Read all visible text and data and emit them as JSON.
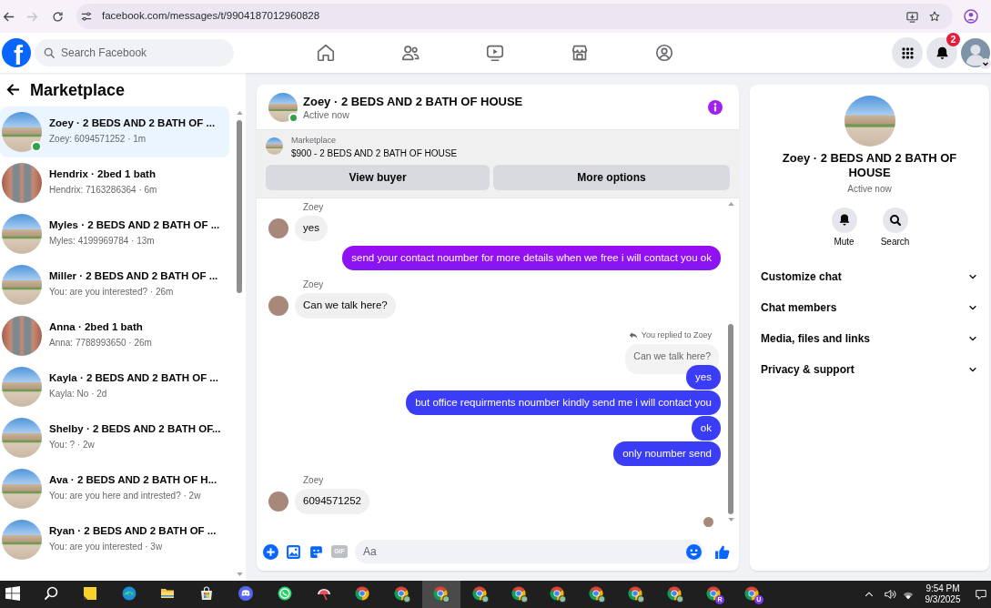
{
  "browser": {
    "url": "facebook.com/messages/t/9904187012960828",
    "forward_disabled": true
  },
  "topbar": {
    "logo": "f",
    "search_placeholder": "Search Facebook",
    "notification_count": "2"
  },
  "sidebar": {
    "title": "Marketplace",
    "conversations": [
      {
        "kind": "house",
        "title": "Zoey · 2 BEDS AND 2 BATH OF ...",
        "preview": "Zoey: 6094571252 · 1m",
        "selected": true,
        "online": true
      },
      {
        "kind": "brick",
        "title": "Hendrix · 2bed 1 bath",
        "preview": "Hendrix: 7163286364 · 6m",
        "selected": false,
        "online": false
      },
      {
        "kind": "house",
        "title": "Myles · 2 BEDS AND 2 BATH OF ...",
        "preview": "Myles: 4199969784 · 13m",
        "selected": false,
        "online": false
      },
      {
        "kind": "house",
        "title": "Miller · 2 BEDS AND 2 BATH OF ...",
        "preview": "You: are you interested? · 26m",
        "selected": false,
        "online": false
      },
      {
        "kind": "brick",
        "title": "Anna · 2bed 1 bath",
        "preview": "Anna: 7788993650 · 26m",
        "selected": false,
        "online": false
      },
      {
        "kind": "house",
        "title": "Kayla · 2 BEDS AND 2 BATH OF ...",
        "preview": "Kayla: No · 2d",
        "selected": false,
        "online": false
      },
      {
        "kind": "house",
        "title": "Shelby · 2 BEDS AND 2 BATH OF...",
        "preview": "You: ? · 2w",
        "selected": false,
        "online": false
      },
      {
        "kind": "house",
        "title": "Ava · 2 BEDS AND 2 BATH OF H...",
        "preview": "You: are you here and intrested? · 2w",
        "selected": false,
        "online": false
      },
      {
        "kind": "house",
        "title": "Ryan · 2 BEDS AND 2 BATH OF ...",
        "preview": "You: are you interested · 3w",
        "selected": false,
        "online": false
      }
    ]
  },
  "chat": {
    "title": "Zoey · 2 BEDS AND 2 BATH OF HOUSE",
    "status": "Active now",
    "online": true,
    "listing": {
      "label": "Marketplace",
      "title": "$900 - 2 BEDS AND 2 BATH OF HOUSE"
    },
    "actions": [
      "View buyer",
      "More options"
    ],
    "messages": [
      {
        "kind": "incoming",
        "sender": "Zoey",
        "text": "yes"
      },
      {
        "kind": "outgoing",
        "text": "send your contact noumber for more details when we free i will contact you ok"
      },
      {
        "kind": "incoming",
        "sender": "Zoey",
        "text": "Can we talk here?"
      },
      {
        "kind": "reply",
        "note": "You replied to Zoey",
        "quote": "Can we talk here?",
        "text": "yes"
      },
      {
        "kind": "outgoing",
        "text": "but office requirments noumber kindly send me i will contact you"
      },
      {
        "kind": "outgoing",
        "text": "ok"
      },
      {
        "kind": "outgoing",
        "text": "only noumber send"
      },
      {
        "kind": "incoming",
        "sender": "Zoey",
        "text": "6094571252"
      }
    ],
    "composer": {
      "gif_label": "GIF",
      "placeholder": "Aa"
    }
  },
  "details": {
    "title": "Zoey · 2 BEDS AND 2 BATH OF HOUSE",
    "status": "Active now",
    "actions": [
      {
        "kind": "mute",
        "label": "Mute"
      },
      {
        "kind": "search",
        "label": "Search"
      }
    ],
    "sections": [
      {
        "label": "Customize chat",
        "expanded": false
      },
      {
        "label": "Chat members",
        "expanded": false
      },
      {
        "label": "Media, files and links",
        "expanded": false
      },
      {
        "label": "Privacy & support",
        "expanded": false
      }
    ]
  },
  "taskbar": {
    "items": [
      {
        "kind": "start",
        "selected": false
      },
      {
        "kind": "search",
        "selected": false
      },
      {
        "kind": "notes",
        "selected": false
      },
      {
        "kind": "edge",
        "selected": false
      },
      {
        "kind": "explorer",
        "selected": false
      },
      {
        "kind": "store",
        "selected": false
      },
      {
        "kind": "discord",
        "selected": false
      },
      {
        "kind": "whatsapp",
        "selected": false
      },
      {
        "kind": "paint",
        "selected": false
      },
      {
        "kind": "chrome",
        "avatar": false,
        "selected": false
      },
      {
        "kind": "chrome",
        "avatar": true,
        "selected": false
      },
      {
        "kind": "chrome",
        "avatar": true,
        "selected": true
      },
      {
        "kind": "chrome",
        "avatar": true,
        "selected": false
      },
      {
        "kind": "chrome",
        "avatar": true,
        "selected": false
      },
      {
        "kind": "chrome",
        "avatar": true,
        "selected": false
      },
      {
        "kind": "chrome",
        "avatar": true,
        "selected": false
      },
      {
        "kind": "chrome",
        "avatar": true,
        "selected": false
      },
      {
        "kind": "chrome",
        "avatar": true,
        "selected": false
      },
      {
        "kind": "chrome",
        "avatar": false,
        "badge": "R",
        "selected": false
      },
      {
        "kind": "chrome",
        "avatar": false,
        "badge": "U",
        "selected": false
      }
    ],
    "time": "9:54 PM",
    "date": "9/3/2025"
  }
}
